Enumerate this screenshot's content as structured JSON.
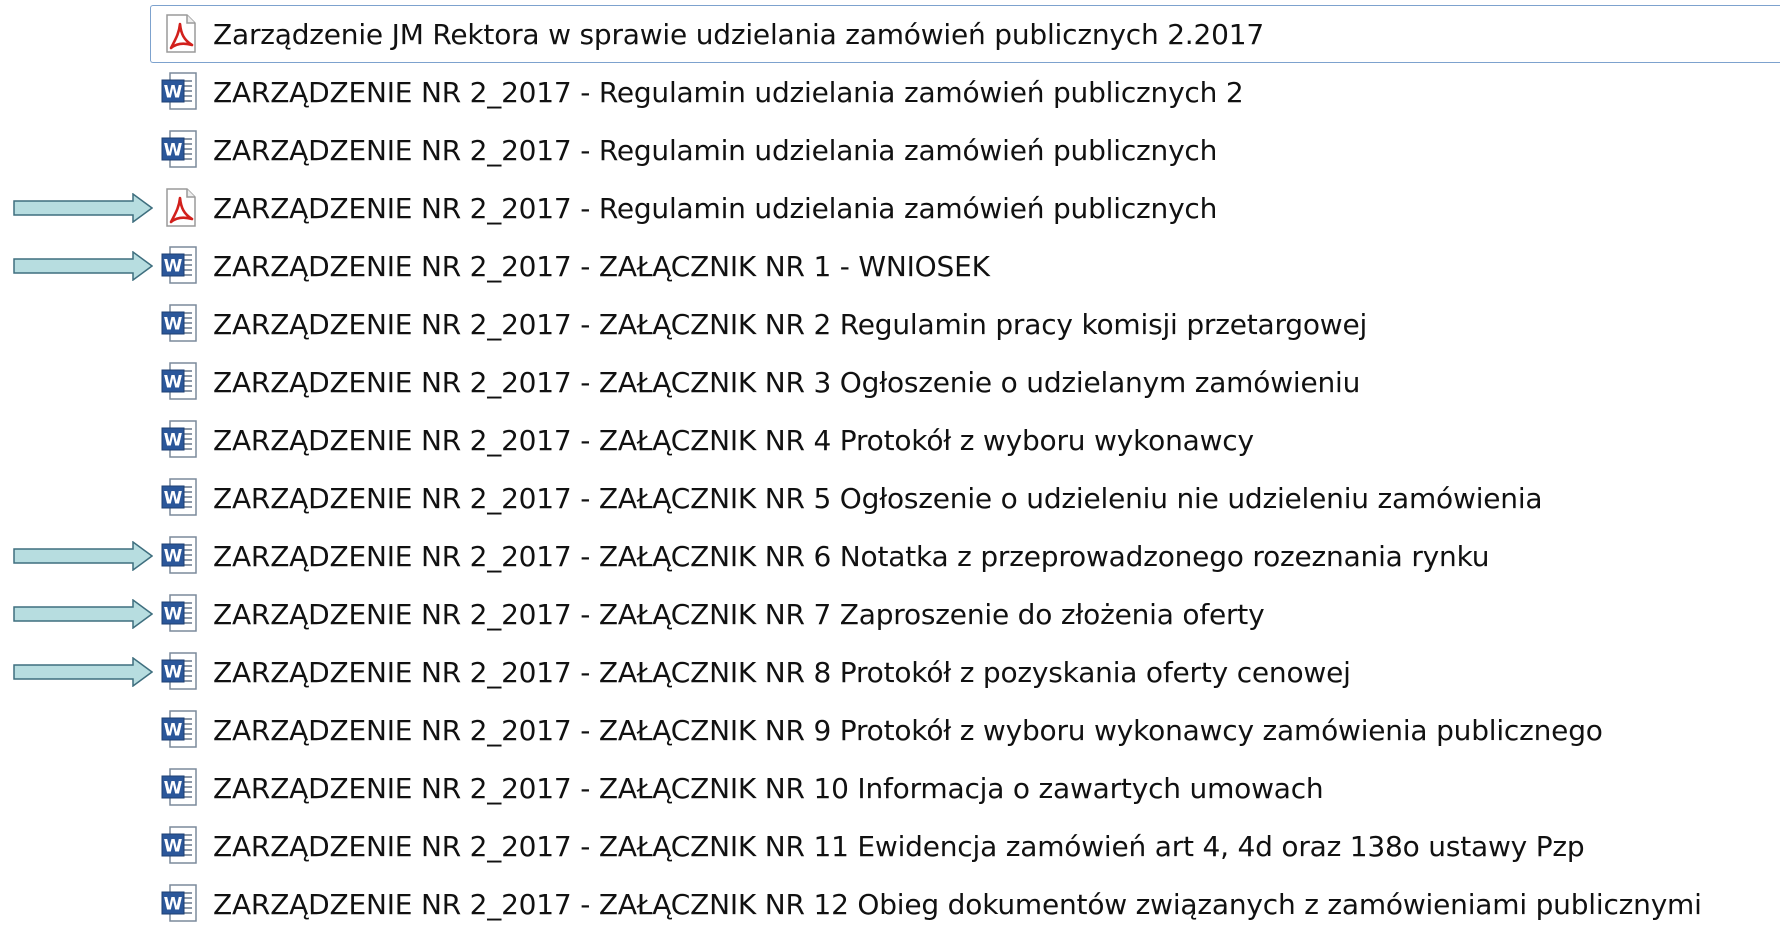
{
  "colors": {
    "arrow_fill": "#b7dde0",
    "arrow_stroke": "#3f6f7f",
    "selection_border": "#7da2ce",
    "word_icon": "#2b579a",
    "pdf_icon": "#d2201c"
  },
  "files": [
    {
      "name": "Zarządzenie JM Rektora w sprawie udzielania zamówień publicznych 2.2017",
      "icon": "pdf-icon",
      "selected": true,
      "arrow": false
    },
    {
      "name": "ZARZĄDZENIE NR 2_2017 -  Regulamin udzielania zamówień publicznych 2",
      "icon": "word-document-icon",
      "selected": false,
      "arrow": false
    },
    {
      "name": "ZARZĄDZENIE NR 2_2017 -  Regulamin udzielania zamówień publicznych",
      "icon": "word-document-icon",
      "selected": false,
      "arrow": false
    },
    {
      "name": "ZARZĄDZENIE NR 2_2017 -  Regulamin udzielania zamówień publicznych",
      "icon": "pdf-icon",
      "selected": false,
      "arrow": true
    },
    {
      "name": "ZARZĄDZENIE NR 2_2017 -  ZAŁĄCZNIK NR 1 - WNIOSEK",
      "icon": "word-document-icon",
      "selected": false,
      "arrow": true
    },
    {
      "name": "ZARZĄDZENIE NR 2_2017 - ZAŁĄCZNIK NR 2 Regulamin pracy komisji przetargowej",
      "icon": "word-document-icon",
      "selected": false,
      "arrow": false
    },
    {
      "name": "ZARZĄDZENIE NR 2_2017 - ZAŁĄCZNIK NR 3 Ogłoszenie o udzielanym zamówieniu",
      "icon": "word-document-icon",
      "selected": false,
      "arrow": false
    },
    {
      "name": "ZARZĄDZENIE NR 2_2017 - ZAŁĄCZNIK NR 4  Protokół z wyboru wykonawcy",
      "icon": "word-document-icon",
      "selected": false,
      "arrow": false
    },
    {
      "name": "ZARZĄDZENIE NR 2_2017 - ZAŁĄCZNIK NR 5 Ogłoszenie o udzieleniu nie udzieleniu zamówienia",
      "icon": "word-document-icon",
      "selected": false,
      "arrow": false
    },
    {
      "name": "ZARZĄDZENIE NR 2_2017 - ZAŁĄCZNIK NR 6 Notatka z przeprowadzonego rozeznania rynku",
      "icon": "word-document-icon",
      "selected": false,
      "arrow": true
    },
    {
      "name": "ZARZĄDZENIE NR 2_2017 - ZAŁĄCZNIK NR 7 Zaproszenie do złożenia oferty",
      "icon": "word-document-icon",
      "selected": false,
      "arrow": true
    },
    {
      "name": "ZARZĄDZENIE NR 2_2017 - ZAŁĄCZNIK NR 8 Protokół z pozyskania oferty cenowej",
      "icon": "word-document-icon",
      "selected": false,
      "arrow": true
    },
    {
      "name": "ZARZĄDZENIE NR 2_2017 - ZAŁĄCZNIK NR 9 Protokół z wyboru wykonawcy zamówienia publicznego",
      "icon": "word-document-icon",
      "selected": false,
      "arrow": false
    },
    {
      "name": "ZARZĄDZENIE NR 2_2017 - ZAŁĄCZNIK NR 10 Informacja o zawartych umowach",
      "icon": "word-document-icon",
      "selected": false,
      "arrow": false
    },
    {
      "name": "ZARZĄDZENIE NR 2_2017 - ZAŁĄCZNIK NR 11 Ewidencja zamówień art 4, 4d oraz 138o ustawy Pzp",
      "icon": "word-document-icon",
      "selected": false,
      "arrow": false
    },
    {
      "name": "ZARZĄDZENIE NR 2_2017 - ZAŁĄCZNIK NR 12 Obieg dokumentów związanych z zamówieniami publicznymi",
      "icon": "word-document-icon",
      "selected": false,
      "arrow": false
    }
  ]
}
